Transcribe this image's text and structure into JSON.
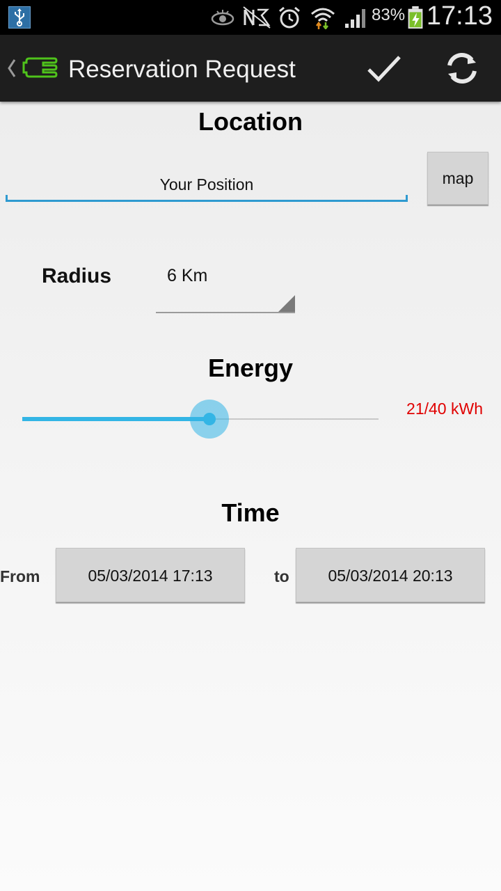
{
  "status_bar": {
    "battery_percent": "83%",
    "time": "17:13",
    "icons": [
      "usb-icon",
      "eye-icon",
      "nfc-icon",
      "alarm-icon",
      "wifi-icon",
      "signal-icon",
      "battery-charging-icon"
    ]
  },
  "action_bar": {
    "title": "Reservation Request",
    "confirm_icon": "check-icon",
    "refresh_icon": "refresh-icon"
  },
  "location": {
    "heading": "Location",
    "value": "Your Position",
    "map_button": "map"
  },
  "radius": {
    "label": "Radius",
    "selected": "6 Km"
  },
  "energy": {
    "heading": "Energy",
    "value_label": "21/40 kWh",
    "current": 21,
    "max": 40
  },
  "time": {
    "heading": "Time",
    "from_label": "From",
    "from_value": "05/03/2014 17:13",
    "to_label": "to",
    "to_value": "05/03/2014 20:13"
  },
  "colors": {
    "accent": "#33b5e5",
    "energy_text": "#e00000",
    "logo_green": "#4fc31b"
  }
}
